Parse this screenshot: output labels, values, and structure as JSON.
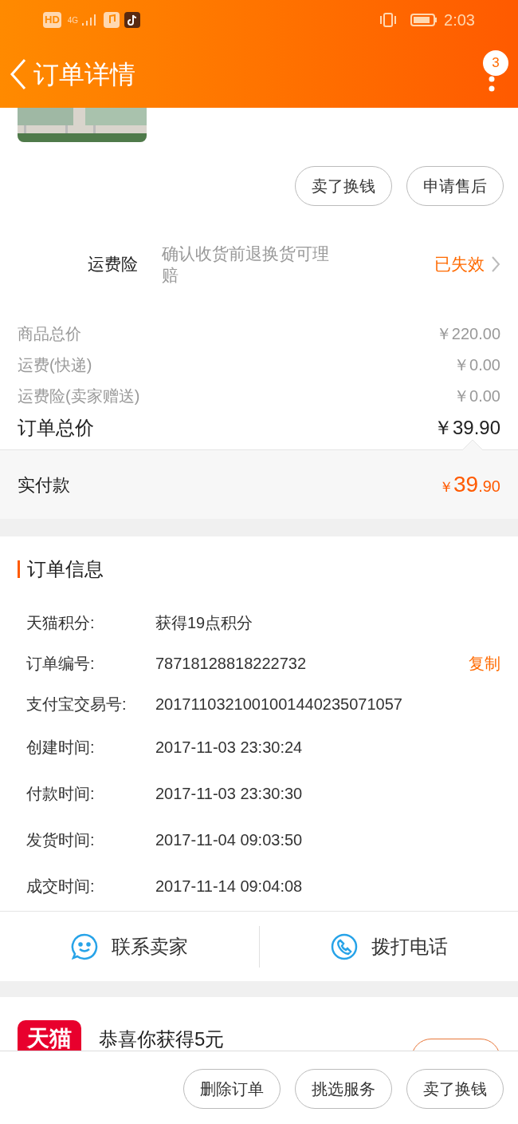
{
  "status_bar": {
    "network": "HD",
    "cell": "4G",
    "time": "2:03"
  },
  "header": {
    "title": "订单详情",
    "badge": "3"
  },
  "product": {
    "kind": "picture"
  },
  "item_actions": [
    "卖了换钱",
    "申请售后"
  ],
  "insurance": {
    "label": "运费险",
    "description": "确认收货前退换货可理赔",
    "status": "已失效"
  },
  "price_rows": [
    {
      "label": "商品总价",
      "value": "￥220.00",
      "kind": "minor"
    },
    {
      "label": "运费(快递)",
      "value": "￥0.00",
      "kind": "minor"
    },
    {
      "label": "运费险(卖家赠送)",
      "value": "￥0.00",
      "kind": "minor"
    },
    {
      "label": "订单总价",
      "value": "￥39.90",
      "kind": "total"
    }
  ],
  "payment": {
    "label": "实付款",
    "currency": "￥",
    "integer": "39",
    "decimal": ".90"
  },
  "order_info": {
    "title": "订单信息",
    "rows": [
      {
        "label": "天猫积分:",
        "value": "获得19点积分"
      },
      {
        "label": "订单编号:",
        "value": "78718128818222732",
        "action": "复制"
      },
      {
        "label": "支付宝交易号:",
        "value": "2017110321001001440235071057"
      },
      {
        "label": "创建时间:",
        "value": "2017-11-03 23:30:24"
      },
      {
        "label": "付款时间:",
        "value": "2017-11-03 23:30:30"
      },
      {
        "label": "发货时间:",
        "value": "2017-11-04 09:03:50"
      },
      {
        "label": "成交时间:",
        "value": "2017-11-14 09:04:08"
      }
    ]
  },
  "contact": [
    {
      "label": "联系卖家",
      "kind": "chat"
    },
    {
      "label": "拨打电话",
      "kind": "phone"
    }
  ],
  "promo": {
    "logo": "天猫",
    "text": "恭喜你获得5元"
  },
  "bottom_actions": [
    "删除订单",
    "挑选服务",
    "卖了换钱"
  ]
}
